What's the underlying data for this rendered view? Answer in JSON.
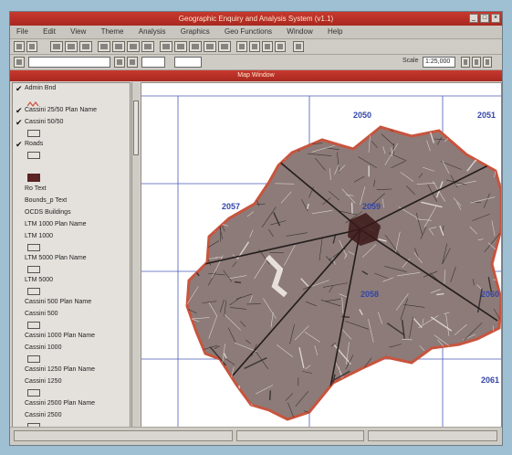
{
  "window": {
    "title": "Geographic Enquiry and Analysis System (v1.1)",
    "map_title": "Map Window"
  },
  "menu": [
    "File",
    "Edit",
    "View",
    "Theme",
    "Analysis",
    "Graphics",
    "Geo Functions",
    "Window",
    "Help"
  ],
  "toolbar": {
    "scale_label": "Scale",
    "scale_value": "1:25,000"
  },
  "layers": [
    {
      "label": "Admin Bnd",
      "checked": true,
      "symbol": "wavy-red"
    },
    {
      "label": "Cassini 25/50 Plan Name",
      "checked": true,
      "symbol": "none"
    },
    {
      "label": "Cassini 50/50",
      "checked": true,
      "symbol": "box"
    },
    {
      "label": "Roads",
      "checked": true,
      "symbol": "box"
    },
    {
      "label": "",
      "checked": false,
      "symbol": "dark-box"
    },
    {
      "label": "Ro Text",
      "checked": false,
      "symbol": "none"
    },
    {
      "label": "Bounds_p Text",
      "checked": false,
      "symbol": "none"
    },
    {
      "label": "OCDS Buildings",
      "checked": false,
      "symbol": "none"
    },
    {
      "label": "LTM 1000 Plan Name",
      "checked": false,
      "symbol": "none"
    },
    {
      "label": "LTM 1000",
      "checked": false,
      "symbol": "box"
    },
    {
      "label": "LTM 5000 Plan Name",
      "checked": false,
      "symbol": "box"
    },
    {
      "label": "LTM 5000",
      "checked": false,
      "symbol": "box"
    },
    {
      "label": "Cassini 500 Plan Name",
      "checked": false,
      "symbol": "none"
    },
    {
      "label": "Cassini 500",
      "checked": false,
      "symbol": "box"
    },
    {
      "label": "Cassini 1000 Plan Name",
      "checked": false,
      "symbol": "none"
    },
    {
      "label": "Cassini 1000",
      "checked": false,
      "symbol": "box"
    },
    {
      "label": "Cassini 1250 Plan Name",
      "checked": false,
      "symbol": "none"
    },
    {
      "label": "Cassini 1250",
      "checked": false,
      "symbol": "box"
    },
    {
      "label": "Cassini 2500 Plan Name",
      "checked": false,
      "symbol": "none"
    },
    {
      "label": "Cassini 2500",
      "checked": false,
      "symbol": "box"
    }
  ],
  "map": {
    "sheet_labels": [
      "2050",
      "2051",
      "2057",
      "2059",
      "2058",
      "2060",
      "2061"
    ],
    "colors": {
      "boundary": "#c8543e",
      "grid": "#4a5ab8",
      "roads": "#3a3434",
      "city_fill": "#8c7b78"
    }
  }
}
